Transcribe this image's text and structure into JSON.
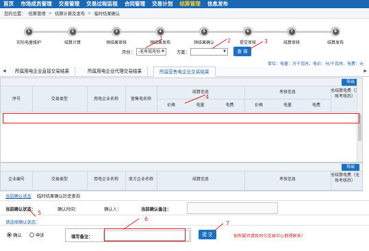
{
  "nav": {
    "items": [
      "首页",
      "市场成员管理",
      "交易管理",
      "交易过程监视",
      "合同管理",
      "交易计划",
      "结算管理",
      "信息发布"
    ],
    "active_index": 6
  },
  "breadcrumb": {
    "prefix": "您的位置：",
    "path": [
      "结算管理",
      "结算计算及发布",
      "临时结果确认"
    ],
    "separator": ">"
  },
  "steps": [
    {
      "num": "1",
      "label": "实际电量维护"
    },
    {
      "num": "2",
      "label": "结算计算"
    },
    {
      "num": "3",
      "label": "预结果审核"
    },
    {
      "num": "4",
      "label": "预结果发布"
    },
    {
      "num": "5",
      "label": "预结果确认"
    },
    {
      "num": "6",
      "label": "提交审核"
    },
    {
      "num": "7",
      "label": "结算审核"
    },
    {
      "num": "8",
      "label": "结算发布"
    }
  ],
  "filter": {
    "month_label": "月份：",
    "month_value": "-无有效月份-",
    "plan_label": "方案：",
    "plan_value": "",
    "query_label": "查 询"
  },
  "unit_note": "单位：电量：万千瓦时，电价：分/千瓦时，电费：元",
  "tabs": [
    "所属用电企业直接交易结果",
    "所属用电企业代理交易结果",
    "所属营售电企业交易结果"
  ],
  "tabs_active": 2,
  "grid1": {
    "export_label": "导出",
    "headers": {
      "seq": "序号",
      "trade_type": "交易类型",
      "buyer_name": "用电企业名称",
      "seller_name": "营售电名称",
      "settle_group": "结算信息",
      "assess_group": "考核信息",
      "total_fee": "总结算电费（无账考核后）",
      "price": "价格",
      "energy": "电量",
      "fee": "电费"
    }
  },
  "grid2": {
    "export_label": "导出",
    "headers": {
      "enterprise_no": "企业编号",
      "trade_type": "交易类型",
      "buyer_name": "用电企业名称",
      "seller_name": "卖方企业名称",
      "settle_group": "结算信息",
      "assess_group": "考核信息",
      "total_fee": "总结算电费（无账考核后）"
    }
  },
  "status_tabs": [
    "当前确认状态",
    "临时结果确认历史查询"
  ],
  "status": {
    "current_label": "当前确认状态：",
    "time_label": "确认时间：",
    "person_label": "确认人：",
    "remark_label": "当前确认备注："
  },
  "choose_label": "请选择确认状态：",
  "confirm": {
    "options": [
      "确认",
      "申诉"
    ],
    "selected": 0,
    "remark_label": "填写备注：",
    "submit_label": "提 交",
    "contact_note": "如有疑问请及时与交易中心取得联系！"
  },
  "annotations": [
    "1",
    "2",
    "3",
    "4",
    "5",
    "6",
    "7"
  ],
  "colors": {
    "nav_bg": "#1a68b4",
    "nav_active": "#ffd21e",
    "button": "#1d70c2",
    "annotation": "#e02020"
  }
}
